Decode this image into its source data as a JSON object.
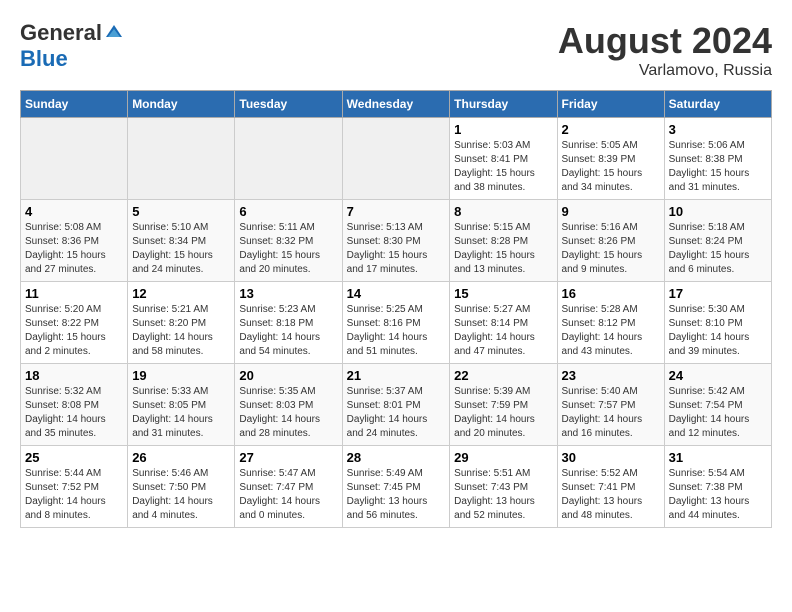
{
  "header": {
    "logo_general": "General",
    "logo_blue": "Blue",
    "month_year": "August 2024",
    "location": "Varlamovo, Russia"
  },
  "weekdays": [
    "Sunday",
    "Monday",
    "Tuesday",
    "Wednesday",
    "Thursday",
    "Friday",
    "Saturday"
  ],
  "weeks": [
    [
      {
        "day": "",
        "info": ""
      },
      {
        "day": "",
        "info": ""
      },
      {
        "day": "",
        "info": ""
      },
      {
        "day": "",
        "info": ""
      },
      {
        "day": "1",
        "info": "Sunrise: 5:03 AM\nSunset: 8:41 PM\nDaylight: 15 hours\nand 38 minutes."
      },
      {
        "day": "2",
        "info": "Sunrise: 5:05 AM\nSunset: 8:39 PM\nDaylight: 15 hours\nand 34 minutes."
      },
      {
        "day": "3",
        "info": "Sunrise: 5:06 AM\nSunset: 8:38 PM\nDaylight: 15 hours\nand 31 minutes."
      }
    ],
    [
      {
        "day": "4",
        "info": "Sunrise: 5:08 AM\nSunset: 8:36 PM\nDaylight: 15 hours\nand 27 minutes."
      },
      {
        "day": "5",
        "info": "Sunrise: 5:10 AM\nSunset: 8:34 PM\nDaylight: 15 hours\nand 24 minutes."
      },
      {
        "day": "6",
        "info": "Sunrise: 5:11 AM\nSunset: 8:32 PM\nDaylight: 15 hours\nand 20 minutes."
      },
      {
        "day": "7",
        "info": "Sunrise: 5:13 AM\nSunset: 8:30 PM\nDaylight: 15 hours\nand 17 minutes."
      },
      {
        "day": "8",
        "info": "Sunrise: 5:15 AM\nSunset: 8:28 PM\nDaylight: 15 hours\nand 13 minutes."
      },
      {
        "day": "9",
        "info": "Sunrise: 5:16 AM\nSunset: 8:26 PM\nDaylight: 15 hours\nand 9 minutes."
      },
      {
        "day": "10",
        "info": "Sunrise: 5:18 AM\nSunset: 8:24 PM\nDaylight: 15 hours\nand 6 minutes."
      }
    ],
    [
      {
        "day": "11",
        "info": "Sunrise: 5:20 AM\nSunset: 8:22 PM\nDaylight: 15 hours\nand 2 minutes."
      },
      {
        "day": "12",
        "info": "Sunrise: 5:21 AM\nSunset: 8:20 PM\nDaylight: 14 hours\nand 58 minutes."
      },
      {
        "day": "13",
        "info": "Sunrise: 5:23 AM\nSunset: 8:18 PM\nDaylight: 14 hours\nand 54 minutes."
      },
      {
        "day": "14",
        "info": "Sunrise: 5:25 AM\nSunset: 8:16 PM\nDaylight: 14 hours\nand 51 minutes."
      },
      {
        "day": "15",
        "info": "Sunrise: 5:27 AM\nSunset: 8:14 PM\nDaylight: 14 hours\nand 47 minutes."
      },
      {
        "day": "16",
        "info": "Sunrise: 5:28 AM\nSunset: 8:12 PM\nDaylight: 14 hours\nand 43 minutes."
      },
      {
        "day": "17",
        "info": "Sunrise: 5:30 AM\nSunset: 8:10 PM\nDaylight: 14 hours\nand 39 minutes."
      }
    ],
    [
      {
        "day": "18",
        "info": "Sunrise: 5:32 AM\nSunset: 8:08 PM\nDaylight: 14 hours\nand 35 minutes."
      },
      {
        "day": "19",
        "info": "Sunrise: 5:33 AM\nSunset: 8:05 PM\nDaylight: 14 hours\nand 31 minutes."
      },
      {
        "day": "20",
        "info": "Sunrise: 5:35 AM\nSunset: 8:03 PM\nDaylight: 14 hours\nand 28 minutes."
      },
      {
        "day": "21",
        "info": "Sunrise: 5:37 AM\nSunset: 8:01 PM\nDaylight: 14 hours\nand 24 minutes."
      },
      {
        "day": "22",
        "info": "Sunrise: 5:39 AM\nSunset: 7:59 PM\nDaylight: 14 hours\nand 20 minutes."
      },
      {
        "day": "23",
        "info": "Sunrise: 5:40 AM\nSunset: 7:57 PM\nDaylight: 14 hours\nand 16 minutes."
      },
      {
        "day": "24",
        "info": "Sunrise: 5:42 AM\nSunset: 7:54 PM\nDaylight: 14 hours\nand 12 minutes."
      }
    ],
    [
      {
        "day": "25",
        "info": "Sunrise: 5:44 AM\nSunset: 7:52 PM\nDaylight: 14 hours\nand 8 minutes."
      },
      {
        "day": "26",
        "info": "Sunrise: 5:46 AM\nSunset: 7:50 PM\nDaylight: 14 hours\nand 4 minutes."
      },
      {
        "day": "27",
        "info": "Sunrise: 5:47 AM\nSunset: 7:47 PM\nDaylight: 14 hours\nand 0 minutes."
      },
      {
        "day": "28",
        "info": "Sunrise: 5:49 AM\nSunset: 7:45 PM\nDaylight: 13 hours\nand 56 minutes."
      },
      {
        "day": "29",
        "info": "Sunrise: 5:51 AM\nSunset: 7:43 PM\nDaylight: 13 hours\nand 52 minutes."
      },
      {
        "day": "30",
        "info": "Sunrise: 5:52 AM\nSunset: 7:41 PM\nDaylight: 13 hours\nand 48 minutes."
      },
      {
        "day": "31",
        "info": "Sunrise: 5:54 AM\nSunset: 7:38 PM\nDaylight: 13 hours\nand 44 minutes."
      }
    ]
  ]
}
